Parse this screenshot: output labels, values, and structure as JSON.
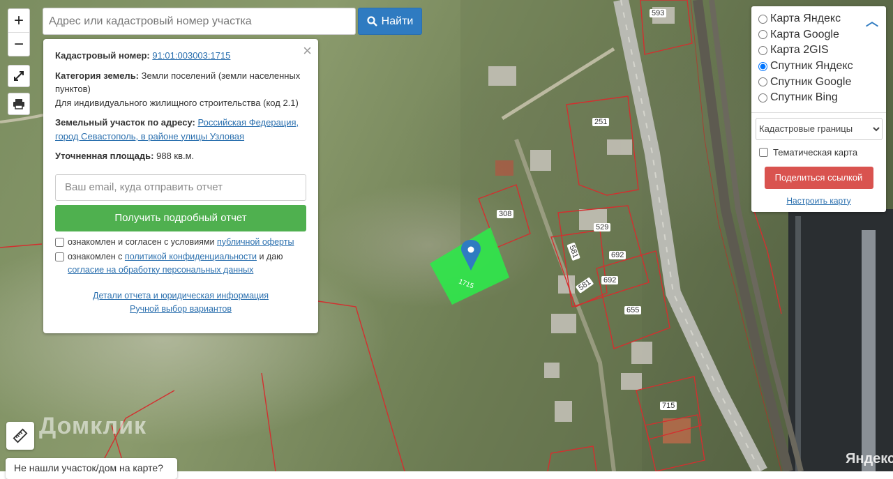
{
  "search": {
    "placeholder": "Адрес или кадастровый номер участка",
    "button_label": "Найти"
  },
  "zoom": {
    "in": "+",
    "out": "−"
  },
  "info": {
    "cadastral_label": "Кадастровый номер:",
    "cadastral_value": "91:01:003003:1715",
    "category_label": "Категория земель:",
    "category_value": "Земли поселений (земли населенных пунктов)",
    "usage": "Для индивидуального жилищного строительства (код 2.1)",
    "address_label": "Земельный участок по адресу:",
    "address_value": "Российская Федерация, город Севастополь, в районе улицы Узловая",
    "area_label": "Уточненная площадь:",
    "area_value": "988 кв.м.",
    "email_placeholder": "Ваш email, куда отправить отчет",
    "report_button": "Получить подробный отчет",
    "consent1_pre": "ознакомлен и согласен с условиями",
    "consent1_link": "публичной оферты",
    "consent2_pre": "ознакомлен с",
    "consent2_link": "политикой конфиденциальности",
    "consent2_mid": "и даю",
    "consent2_link2": "согласие на обработку персональных данных",
    "details_link": "Детали отчета и юридическая информация",
    "manual_link": "Ручной выбор вариантов",
    "close": "×"
  },
  "layers": {
    "options": [
      "Карта Яндекс",
      "Карта Google",
      "Карта 2GIS",
      "Спутник Яндекс",
      "Спутник Google",
      "Спутник Bing"
    ],
    "selected_index": 3,
    "cadastral_select": "Кадастровые границы",
    "thematic_label": "Тематическая карта",
    "share_button": "Поделиться ссылкой",
    "configure_link": "Настроить карту"
  },
  "map": {
    "plot_numbers": [
      "593",
      "251",
      "308",
      "529",
      "581",
      "692",
      "692",
      "581",
      "655",
      "715",
      "1715"
    ],
    "watermarks": {
      "domclick": "Домклик",
      "yandex": "Яндекс"
    },
    "colors": {
      "selected_plot": "#2ee84a",
      "boundary": "#d32f2f",
      "marker": "#2f7bc1"
    }
  },
  "bottom": {
    "not_found": "Не нашли участок/дом на карте?"
  }
}
